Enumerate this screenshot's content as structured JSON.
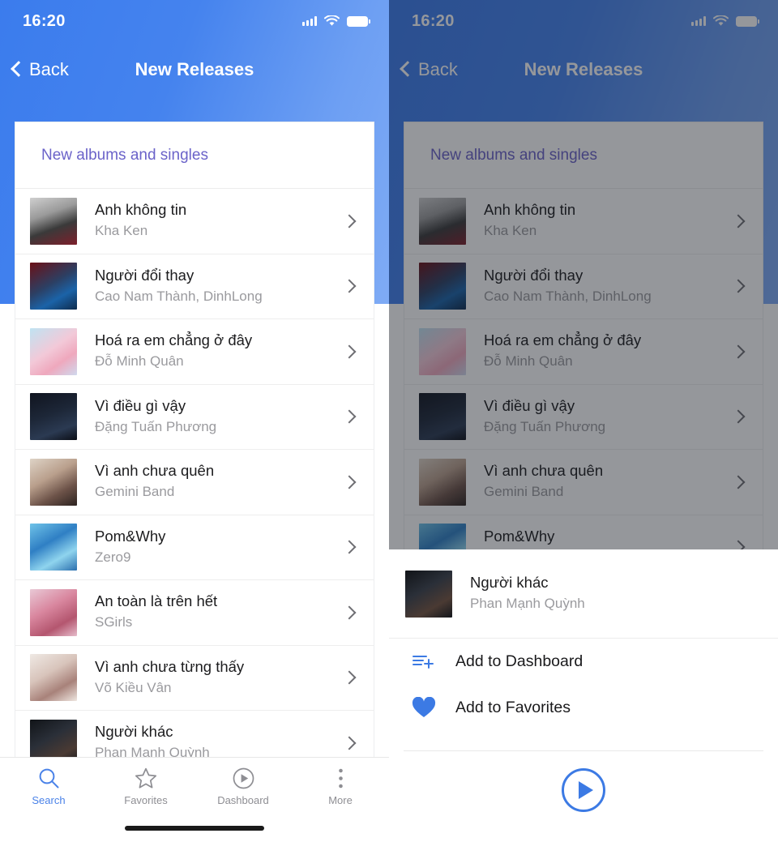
{
  "status_bar": {
    "time": "16:20",
    "signal_icon": "cellular-bars-icon",
    "wifi_icon": "wifi-icon",
    "battery_icon": "battery-icon"
  },
  "nav": {
    "back_label": "Back",
    "title": "New Releases",
    "back_icon": "chevron-left-icon"
  },
  "section": {
    "heading": "New albums and singles"
  },
  "colors": {
    "accent_blue": "#3c7ae4",
    "heading_purple": "#6b63c9",
    "tab_active": "#4a82e8",
    "subtitle_gray": "#9a9a9e"
  },
  "songs": [
    {
      "title": "Anh không tin",
      "artist": "Kha Ken",
      "art": "album-art-anh-khong-tin"
    },
    {
      "title": "Người đổi thay",
      "artist": "Cao Nam Thành, DinhLong",
      "art": "album-art-nguoi-doi-thay"
    },
    {
      "title": "Hoá ra em chẳng ở đây",
      "artist": "Đỗ Minh Quân",
      "art": "album-art-hoa-ra-em-chang-o-day"
    },
    {
      "title": "Vì điều gì vậy",
      "artist": "Đặng Tuấn Phương",
      "art": "album-art-vi-dieu-gi-vay"
    },
    {
      "title": "Vì anh chưa quên",
      "artist": "Gemini Band",
      "art": "album-art-vi-anh-chua-quen"
    },
    {
      "title": "Pom&Why",
      "artist": "Zero9",
      "art": "album-art-pom-and-why"
    },
    {
      "title": "An toàn là trên hết",
      "artist": "SGirls",
      "art": "album-art-an-toan-la-tren-het"
    },
    {
      "title": "Vì anh chưa từng thấy",
      "artist": "Võ Kiều Vân",
      "art": "album-art-vi-anh-chua-tung-thay"
    },
    {
      "title": "Người khác",
      "artist": "Phan Mạnh Quỳnh",
      "art": "album-art-nguoi-khac"
    }
  ],
  "tabs": [
    {
      "label": "Search",
      "icon": "search-icon",
      "active": true
    },
    {
      "label": "Favorites",
      "icon": "star-icon",
      "active": false
    },
    {
      "label": "Dashboard",
      "icon": "play-circle-icon",
      "active": false
    },
    {
      "label": "More",
      "icon": "dots-vertical-icon",
      "active": false
    }
  ],
  "action_sheet": {
    "song": {
      "title": "Người khác",
      "artist": "Phan Mạnh Quỳnh",
      "art": "album-art-nguoi-khac"
    },
    "actions": [
      {
        "label": "Add to Dashboard",
        "icon": "list-plus-icon"
      },
      {
        "label": "Add to Favorites",
        "icon": "heart-filled-icon"
      }
    ],
    "play_button_icon": "play-circle-outline-icon"
  }
}
